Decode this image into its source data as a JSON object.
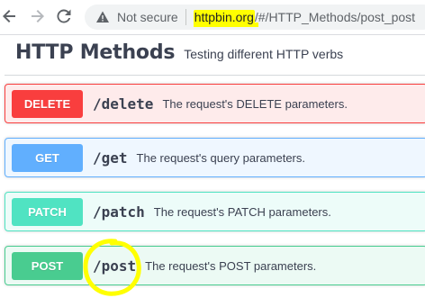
{
  "browser": {
    "security_label": "Not secure",
    "url_host": "httpbin.org",
    "url_path": "/#/HTTP_Methods/post_post",
    "icons": {
      "back": "arrow-left-icon",
      "forward": "arrow-right-icon",
      "reload": "reload-icon",
      "security": "warning-triangle-icon"
    }
  },
  "header": {
    "title": "HTTP Methods",
    "description": "Testing different HTTP verbs"
  },
  "operations": [
    {
      "method": "DELETE",
      "path": "/delete",
      "summary": "The request's DELETE parameters.",
      "color": "#f93e3e"
    },
    {
      "method": "GET",
      "path": "/get",
      "summary": "The request's query parameters.",
      "color": "#61affe"
    },
    {
      "method": "PATCH",
      "path": "/patch",
      "summary": "The request's PATCH parameters.",
      "color": "#50e3c2"
    },
    {
      "method": "POST",
      "path": "/post",
      "summary": "The request's POST parameters.",
      "color": "#49cc90"
    }
  ],
  "annotations": {
    "highlight_color": "#ffff00"
  }
}
